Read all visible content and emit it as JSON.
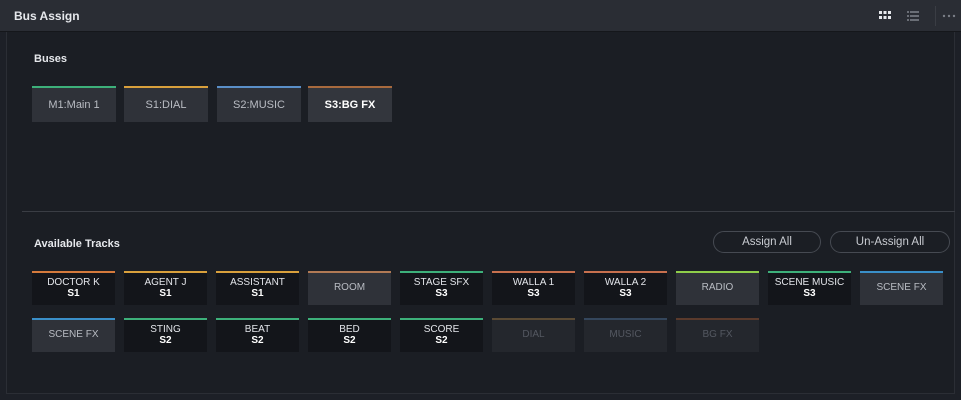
{
  "window": {
    "title": "Bus Assign"
  },
  "toolbar_icons": [
    "grid-view-icon",
    "list-view-icon",
    "more-options-icon"
  ],
  "buses": {
    "label": "Buses",
    "items": [
      {
        "label": "M1:Main 1",
        "color": "#3db07a"
      },
      {
        "label": "S1:DIAL",
        "color": "#d9a03c"
      },
      {
        "label": "S2:MUSIC",
        "color": "#5a8fc8"
      },
      {
        "label": "S3:BG FX",
        "color": "#a86a3e",
        "selected": true
      }
    ]
  },
  "tracks": {
    "label": "Available Tracks",
    "assign_all": "Assign All",
    "unassign_all": "Un-Assign All",
    "items": [
      {
        "name": "DOCTOR K",
        "bus": "S1",
        "color": "#d57a3c",
        "state": "assigned"
      },
      {
        "name": "AGENT J",
        "bus": "S1",
        "color": "#d9a03c",
        "state": "assigned"
      },
      {
        "name": "ASSISTANT",
        "bus": "S1",
        "color": "#d9a03c",
        "state": "assigned"
      },
      {
        "name": "ROOM",
        "bus": "",
        "color": "#b27a55",
        "state": "unassigned"
      },
      {
        "name": "STAGE SFX",
        "bus": "S3",
        "color": "#3db07a",
        "state": "assigned"
      },
      {
        "name": "WALLA 1",
        "bus": "S3",
        "color": "#c7704e",
        "state": "assigned"
      },
      {
        "name": "WALLA 2",
        "bus": "S3",
        "color": "#c7704e",
        "state": "assigned"
      },
      {
        "name": "RADIO",
        "bus": "",
        "color": "#8fce4a",
        "state": "unassigned"
      },
      {
        "name": "SCENE MUSIC",
        "bus": "S3",
        "color": "#3db07a",
        "state": "assigned"
      },
      {
        "name": "SCENE FX",
        "bus": "",
        "color": "#3a8fc8",
        "state": "unassigned"
      },
      {
        "name": "SCENE FX",
        "bus": "",
        "color": "#3a8fc8",
        "state": "unassigned"
      },
      {
        "name": "STING",
        "bus": "S2",
        "color": "#3db07a",
        "state": "assigned"
      },
      {
        "name": "BEAT",
        "bus": "S2",
        "color": "#3db07a",
        "state": "assigned"
      },
      {
        "name": "BED",
        "bus": "S2",
        "color": "#3db07a",
        "state": "assigned"
      },
      {
        "name": "SCORE",
        "bus": "S2",
        "color": "#3db07a",
        "state": "assigned"
      },
      {
        "name": "DIAL",
        "bus": "",
        "color": "#5a4a34",
        "state": "faded"
      },
      {
        "name": "MUSIC",
        "bus": "",
        "color": "#34465c",
        "state": "faded"
      },
      {
        "name": "BG FX",
        "bus": "",
        "color": "#5a3a2c",
        "state": "faded"
      }
    ]
  }
}
